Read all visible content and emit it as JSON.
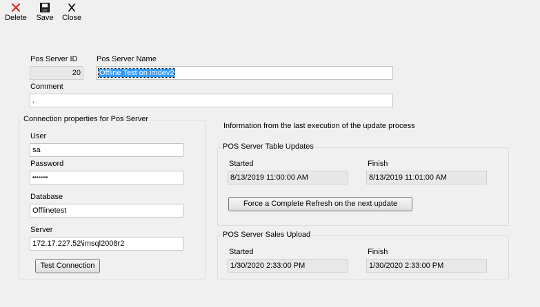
{
  "toolbar": {
    "delete_label": "Delete",
    "save_label": "Save",
    "close_label": "Close"
  },
  "form": {
    "pos_server_id_label": "Pos Server ID",
    "pos_server_id_value": "20",
    "pos_server_name_label": "Pos Server Name",
    "pos_server_name_value": "Offline Test on imdev2",
    "comment_label": "Comment",
    "comment_value": "."
  },
  "connection": {
    "title": "Connection properties for Pos Server",
    "user_label": "User",
    "user_value": "sa",
    "password_label": "Password",
    "password_value": "••••••••",
    "database_label": "Database",
    "database_value": "Offlinetest",
    "server_label": "Server",
    "server_value": "172.17.227.52\\imsql2008r2",
    "test_button_label": "Test Connection"
  },
  "update_info": {
    "heading": "Information from the last execution of the update process",
    "table_updates": {
      "title": "POS Server Table Updates",
      "started_label": "Started",
      "started_value": "8/13/2019 11:00:00 AM",
      "finish_label": "Finish",
      "finish_value": "8/13/2019 11:01:00 AM",
      "refresh_button_label": "Force a Complete Refresh on the  next update"
    },
    "sales_upload": {
      "title": "POS Server Sales Upload",
      "started_label": "Started",
      "started_value": "1/30/2020 2:33:00 PM",
      "finish_label": "Finish",
      "finish_value": "1/30/2020 2:33:00 PM"
    }
  },
  "colors": {
    "delete_icon": "#e02020",
    "selection": "#3399ff",
    "background": "#f0f0f0"
  }
}
